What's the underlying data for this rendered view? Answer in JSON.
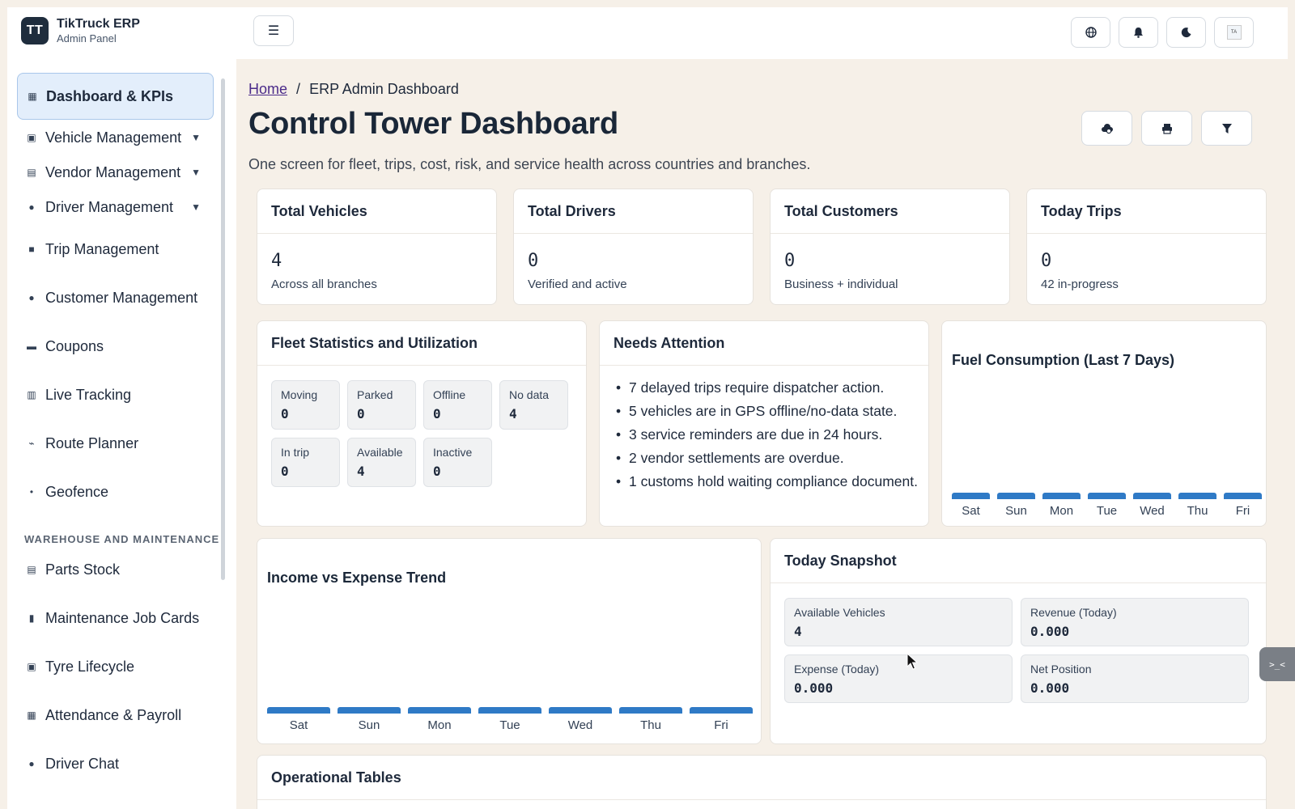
{
  "brand": {
    "logo": "TT",
    "name": "TikTruck ERP",
    "subtitle": "Admin Panel"
  },
  "topbar": {
    "menu_icon": "menu-icon",
    "actions": [
      "globe-icon",
      "bell-icon",
      "moon-icon",
      "avatar"
    ],
    "avatar_initials": "TA"
  },
  "sidebar": {
    "items": [
      {
        "label": "Dashboard & KPIs",
        "icon": "grid-icon",
        "active": true
      },
      {
        "label": "Vehicle Management",
        "icon": "bus-icon",
        "expandable": true
      },
      {
        "label": "Vendor Management",
        "icon": "building-icon",
        "expandable": true
      },
      {
        "label": "Driver Management",
        "icon": "user-icon",
        "expandable": true
      },
      {
        "label": "Trip Management",
        "icon": "truck-icon"
      },
      {
        "label": "Customer Management",
        "icon": "users-icon"
      },
      {
        "label": "Coupons",
        "icon": "ticket-icon"
      },
      {
        "label": "Live Tracking",
        "icon": "map-icon"
      },
      {
        "label": "Route Planner",
        "icon": "route-icon"
      },
      {
        "label": "Geofence",
        "icon": "pin-icon"
      }
    ],
    "section_label": "WAREHOUSE AND MAINTENANCE",
    "section_items": [
      {
        "label": "Parts Stock",
        "icon": "box-icon"
      },
      {
        "label": "Maintenance Job Cards",
        "icon": "clipboard-icon"
      },
      {
        "label": "Tyre Lifecycle",
        "icon": "car-icon"
      },
      {
        "label": "Attendance & Payroll",
        "icon": "calculator-icon"
      },
      {
        "label": "Driver Chat",
        "icon": "chat-icon"
      }
    ]
  },
  "header": {
    "breadcrumb_home": "Home",
    "breadcrumb_sep": "/",
    "breadcrumb_current": "ERP Admin Dashboard",
    "title": "Control Tower Dashboard",
    "subtitle": "One screen for fleet, trips, cost, risk, and service health across countries and branches.",
    "actions": [
      "cloud-sync-icon",
      "print-icon",
      "filter-icon"
    ]
  },
  "kpis": [
    {
      "title": "Total Vehicles",
      "value": "4",
      "sub": "Across all branches"
    },
    {
      "title": "Total Drivers",
      "value": "0",
      "sub": "Verified and active"
    },
    {
      "title": "Total Customers",
      "value": "0",
      "sub": "Business + individual"
    },
    {
      "title": "Today Trips",
      "value": "0",
      "sub": "42 in-progress"
    }
  ],
  "fleet": {
    "title": "Fleet Statistics and Utilization",
    "stats": [
      {
        "label": "Moving",
        "value": "0"
      },
      {
        "label": "Parked",
        "value": "0"
      },
      {
        "label": "Offline",
        "value": "0"
      },
      {
        "label": "No data",
        "value": "4"
      },
      {
        "label": "In trip",
        "value": "0"
      },
      {
        "label": "Available",
        "value": "4"
      },
      {
        "label": "Inactive",
        "value": "0"
      }
    ]
  },
  "attention": {
    "title": "Needs Attention",
    "items": [
      "7 delayed trips require dispatcher action.",
      "5 vehicles are in GPS offline/no-data state.",
      "3 service reminders are due in 24 hours.",
      "2 vendor settlements are overdue.",
      "1 customs hold waiting compliance document."
    ]
  },
  "fuel_chart": {
    "title": "Fuel Consumption (Last 7 Days)",
    "days": [
      "Sat",
      "Sun",
      "Mon",
      "Tue",
      "Wed",
      "Thu",
      "Fri"
    ]
  },
  "income_chart": {
    "title": "Income vs Expense Trend",
    "days": [
      "Sat",
      "Sun",
      "Mon",
      "Tue",
      "Wed",
      "Thu",
      "Fri"
    ]
  },
  "snapshot": {
    "title": "Today Snapshot",
    "items": [
      {
        "label": "Available Vehicles",
        "value": "4"
      },
      {
        "label": "Revenue (Today)",
        "value": "0.000"
      },
      {
        "label": "Expense (Today)",
        "value": "0.000"
      },
      {
        "label": "Net Position",
        "value": "0.000"
      }
    ]
  },
  "tables": {
    "title": "Operational Tables"
  },
  "widget": {
    "label": ">_<"
  },
  "colors": {
    "accent": "#2f7ac6",
    "active_bg": "#e3eefb",
    "page_bg": "#f6f0e8"
  }
}
